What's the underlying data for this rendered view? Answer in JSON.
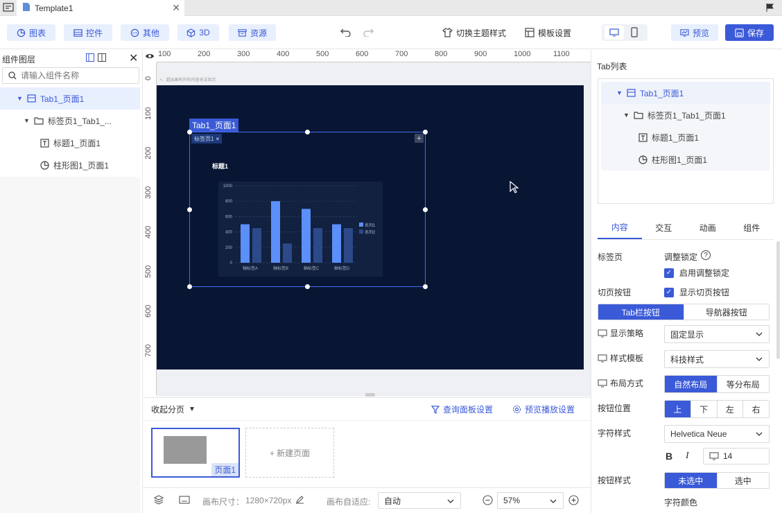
{
  "tabbar": {
    "doc_title": "Template1"
  },
  "toolbar": {
    "chart": "图表",
    "widget": "控件",
    "other": "其他",
    "three_d": "3D",
    "resource": "资源",
    "switch_theme": "切换主题样式",
    "template_settings": "模板设置",
    "preview": "预览",
    "save": "保存"
  },
  "left": {
    "title": "组件图层",
    "search_placeholder": "请输入组件名称",
    "tree": [
      "Tab1_页面1",
      "标签页1_Tab1_...",
      "标题1_页面1",
      "柱形图1_页面1"
    ]
  },
  "ruler": {
    "top": [
      "100",
      "200",
      "300",
      "400",
      "500",
      "600",
      "700",
      "800",
      "900",
      "1000",
      "1100"
    ],
    "left": [
      "0",
      "100",
      "200",
      "300",
      "400",
      "500",
      "600",
      "700"
    ],
    "hint": "×，超出画布外的内容无法显示"
  },
  "canvas": {
    "widget_tag": "Tab1_页面1",
    "inner_tab": "标签页1",
    "plus": "+",
    "chart_title": "标题1"
  },
  "chart_data": {
    "type": "bar",
    "title": "标题1",
    "categories": [
      "轴标签A",
      "轴标签B",
      "轴标签C",
      "轴标签D"
    ],
    "series": [
      {
        "name": "系列1",
        "values": [
          500,
          800,
          700,
          500
        ]
      },
      {
        "name": "系列2",
        "values": [
          450,
          250,
          450,
          450
        ]
      }
    ],
    "ylim": [
      0,
      1000
    ],
    "yticks": [
      "0",
      "200",
      "400",
      "600",
      "800",
      "1000"
    ],
    "grid": true,
    "legend": "right",
    "colors": {
      "s1": "#5b8ff9",
      "s2": "#2c4a8a"
    }
  },
  "pages": {
    "collapse": "收起分页",
    "query_panel": "查询面板设置",
    "preview_play": "预览播放设置",
    "page1": "页面1",
    "new_page": "+ 新建页面"
  },
  "status": {
    "canvas_size_label": "画布尺寸：",
    "canvas_size": "1280×720px",
    "adapt_label": "画布自适应:",
    "adapt_value": "自动",
    "zoom": "57%"
  },
  "right": {
    "tab_list_title": "Tab列表",
    "tree": [
      "Tab1_页面1",
      "标签页1_Tab1_页面1",
      "标题1_页面1",
      "柱形图1_页面1"
    ],
    "tabs": [
      "内容",
      "交互",
      "动画",
      "组件"
    ],
    "tab_page": "标签页",
    "adjust_lock": "调整锁定",
    "enable_lock": "启用调整锁定",
    "switch_btn": "切页按钮",
    "show_switch": "显示切页按钮",
    "btn_type": [
      "Tab栏按钮",
      "导航器按钮"
    ],
    "display_strategy": "显示策略",
    "display_value": "固定显示",
    "style_template": "样式模板",
    "style_value": "科技样式",
    "layout": "布局方式",
    "layout_opts": [
      "自然布局",
      "等分布局"
    ],
    "btn_position": "按钮位置",
    "pos_opts": [
      "上",
      "下",
      "左",
      "右"
    ],
    "font_style": "字符样式",
    "font_value": "Helvetica Neue",
    "bold": "B",
    "italic": "I",
    "font_size": "14",
    "btn_style": "按钮样式",
    "btn_style_opts": [
      "未选中",
      "选中"
    ],
    "font_color": "字符颜色"
  }
}
